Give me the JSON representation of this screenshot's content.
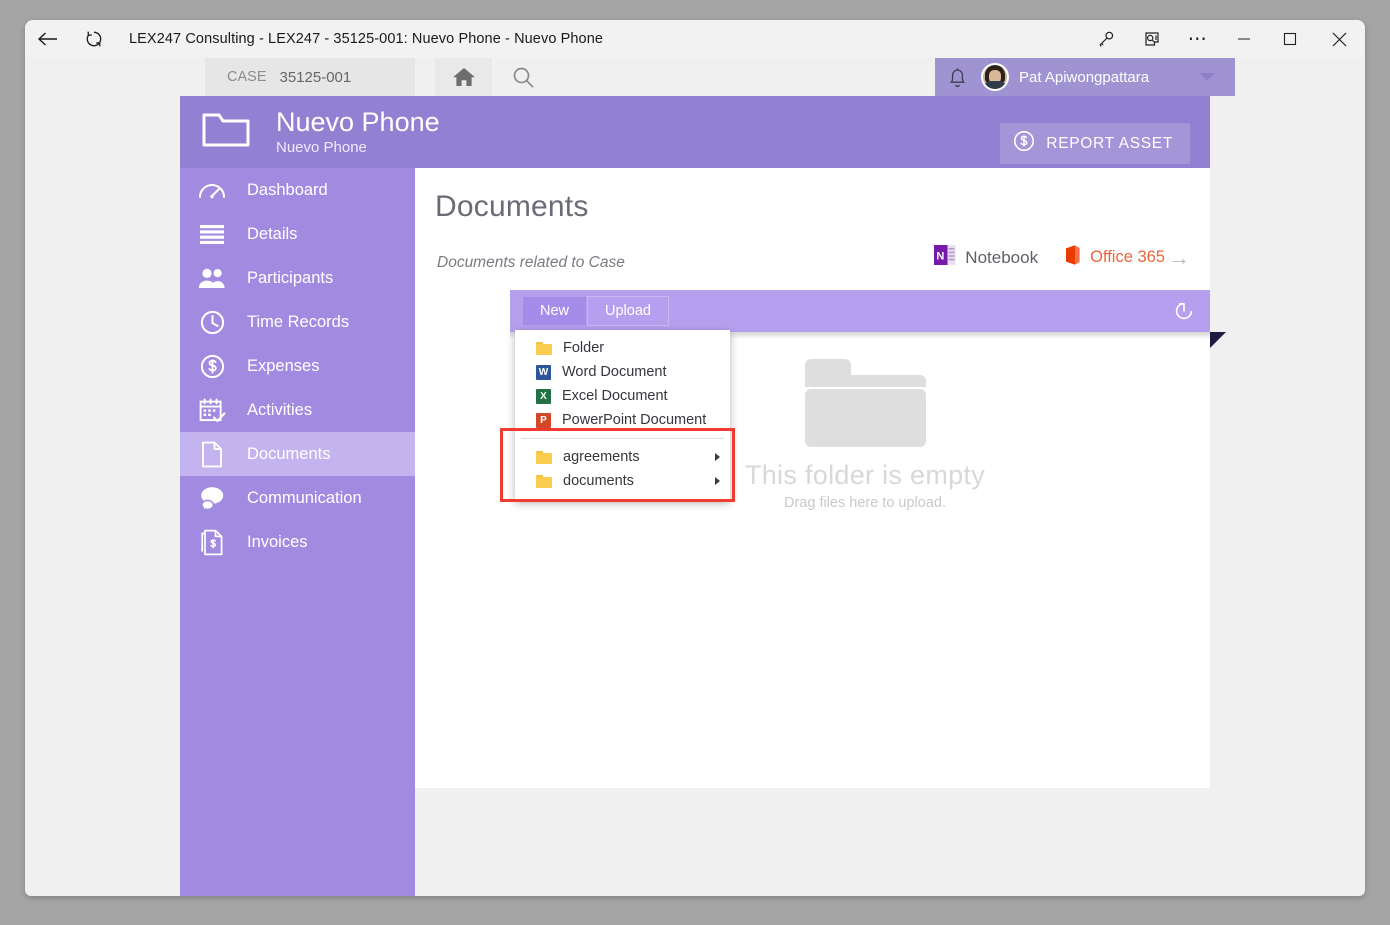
{
  "window": {
    "title": "LEX247 Consulting - LEX247 - 35125-001: Nuevo Phone - Nuevo Phone",
    "back_icon": "back-arrow-icon",
    "refresh_icon": "refresh-icon",
    "key_icon": "key-icon",
    "annotation_icon": "annotation-icon",
    "more_icon": "more-ellipsis-icon",
    "minimize_icon": "minimize-icon",
    "maximize_icon": "maximize-icon",
    "close_icon": "close-icon"
  },
  "topnav": {
    "case_label": "CASE",
    "case_value": "35125-001",
    "home_icon": "home-icon",
    "search_icon": "search-icon",
    "bell_icon": "notification-bell-icon",
    "user_name": "Pat Apiwongpattara",
    "caret_icon": "chevron-down-icon"
  },
  "record_header": {
    "folder_icon": "folder-outline-icon",
    "title": "Nuevo Phone",
    "subtitle": "Nuevo Phone",
    "report_asset_label": "REPORT ASSET",
    "report_asset_icon": "dollar-circle-icon"
  },
  "sidebar": {
    "items": [
      {
        "label": "Dashboard",
        "icon": "gauge-icon",
        "active": false
      },
      {
        "label": "Details",
        "icon": "lines-icon",
        "active": false
      },
      {
        "label": "Participants",
        "icon": "people-icon",
        "active": false
      },
      {
        "label": "Time Records",
        "icon": "clock-icon",
        "active": false
      },
      {
        "label": "Expenses",
        "icon": "dollar-circle-icon",
        "active": false
      },
      {
        "label": "Activities",
        "icon": "calendar-check-icon",
        "active": false
      },
      {
        "label": "Documents",
        "icon": "document-icon",
        "active": true
      },
      {
        "label": "Communication",
        "icon": "speech-bubbles-icon",
        "active": false
      },
      {
        "label": "Invoices",
        "icon": "invoice-icon",
        "active": false
      }
    ]
  },
  "main": {
    "page_title": "Documents",
    "page_subtitle": "Documents related to Case",
    "quicklinks": [
      {
        "label": "Notebook",
        "icon": "onenote-icon"
      },
      {
        "label": "Office 365",
        "icon": "office365-icon"
      }
    ],
    "quicklink_arrow": "→",
    "toolbar": {
      "new_label": "New",
      "upload_label": "Upload",
      "refresh_icon": "refresh-circular-icon"
    },
    "empty_state": {
      "folder_icon": "empty-folder-icon",
      "title": "This folder is empty",
      "hint": "Drag files here to upload."
    }
  },
  "new_menu": {
    "items": [
      {
        "label": "Folder",
        "icon": "folder-icon",
        "submenu": false
      },
      {
        "label": "Word Document",
        "icon": "word-icon",
        "submenu": false
      },
      {
        "label": "Excel Document",
        "icon": "excel-icon",
        "submenu": false
      },
      {
        "label": "PowerPoint Document",
        "icon": "powerpoint-icon",
        "submenu": false
      }
    ],
    "folders": [
      {
        "label": "agreements",
        "icon": "folder-icon",
        "submenu": true
      },
      {
        "label": "documents",
        "icon": "folder-icon",
        "submenu": true
      }
    ]
  },
  "annotation": {
    "color": "#f03c30"
  },
  "colors": {
    "sidebar_purple": "#a18ae0",
    "sidebar_active": "#c3b4ef",
    "header_purple": "#9280d2",
    "toolbar_purple": "#b69fee",
    "office_orange": "#e8663a",
    "annotation_red": "#f03c30"
  }
}
